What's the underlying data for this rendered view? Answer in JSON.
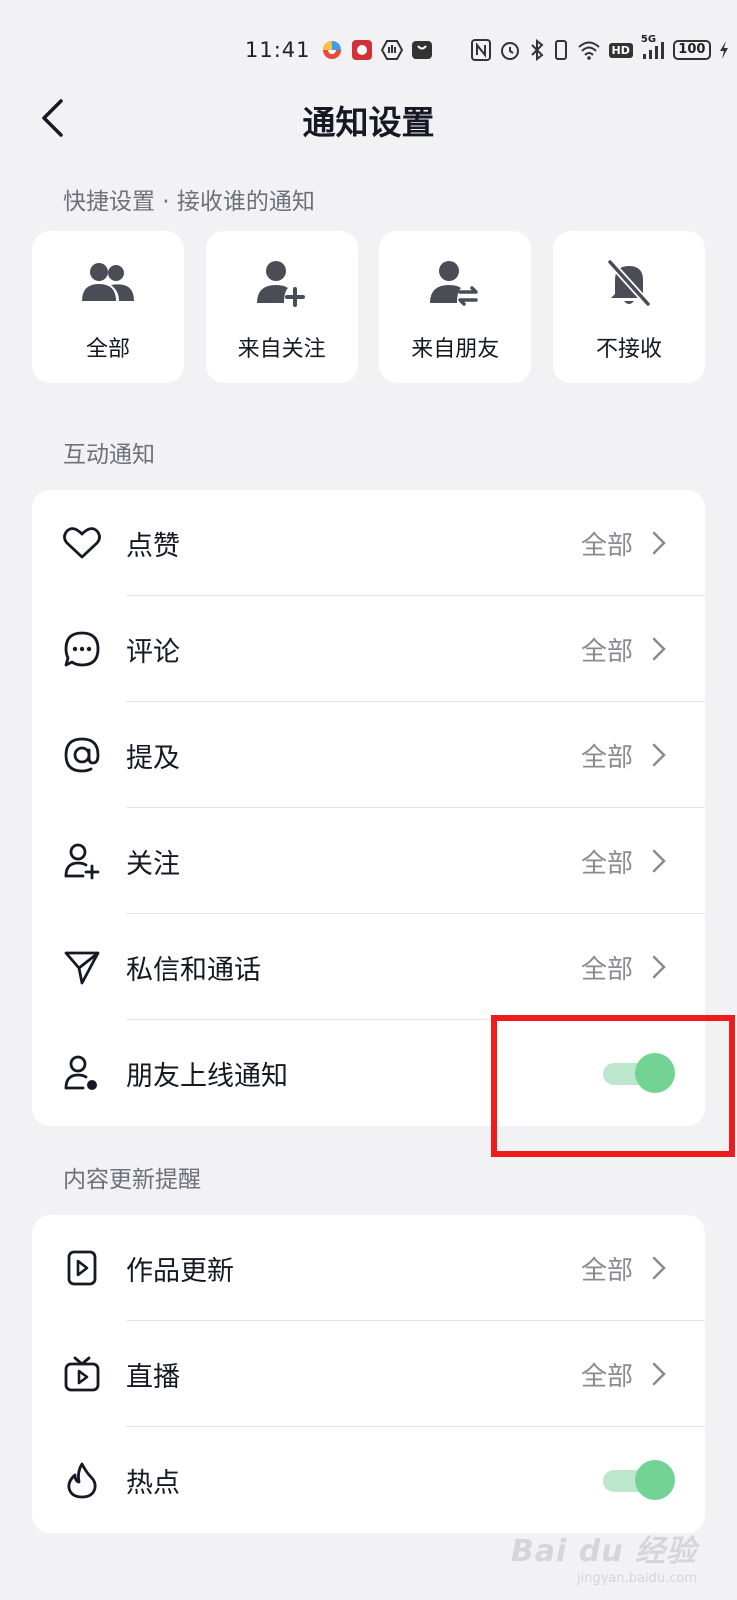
{
  "status_bar": {
    "time": "11:41",
    "network": "5G",
    "hd": "HD",
    "battery": "100"
  },
  "header": {
    "title": "通知设置"
  },
  "quick_settings": {
    "title": "快捷设置 · 接收谁的通知",
    "items": [
      {
        "label": "全部",
        "icon": "group-icon"
      },
      {
        "label": "来自关注",
        "icon": "add-user-icon"
      },
      {
        "label": "来自朋友",
        "icon": "friend-exchange-icon"
      },
      {
        "label": "不接收",
        "icon": "bell-off-icon"
      }
    ]
  },
  "interaction": {
    "title": "互动通知",
    "rows": [
      {
        "label": "点赞",
        "value": "全部",
        "icon": "heart-icon"
      },
      {
        "label": "评论",
        "value": "全部",
        "icon": "comment-icon"
      },
      {
        "label": "提及",
        "value": "全部",
        "icon": "at-icon"
      },
      {
        "label": "关注",
        "value": "全部",
        "icon": "follow-icon"
      },
      {
        "label": "私信和通话",
        "value": "全部",
        "icon": "send-icon"
      },
      {
        "label": "朋友上线通知",
        "toggle": true,
        "icon": "user-online-icon"
      }
    ]
  },
  "content_updates": {
    "title": "内容更新提醒",
    "rows": [
      {
        "label": "作品更新",
        "value": "全部",
        "icon": "video-icon"
      },
      {
        "label": "直播",
        "value": "全部",
        "icon": "tv-icon"
      },
      {
        "label": "热点",
        "toggle": true,
        "icon": "flame-icon"
      }
    ]
  },
  "colors": {
    "toggle_on_knob": "#72d394",
    "toggle_on_track": "#bde7cd",
    "highlight": "#ee1c1c"
  },
  "watermark": {
    "main": "Bai du 经验",
    "sub": "jingyan.baidu.com"
  }
}
